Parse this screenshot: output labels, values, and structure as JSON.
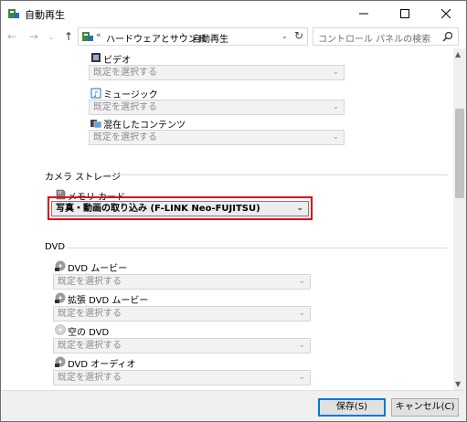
{
  "window": {
    "title": "自動再生"
  },
  "nav": {
    "address_chevron": "«",
    "address_segment_1": "ハードウェアとサウンド",
    "address_separator": "›",
    "address_segment_2": "自動再生",
    "search_placeholder": "コントロール パネルの検索"
  },
  "content": {
    "media_items": [
      {
        "label": "ビデオ",
        "icon": "video-icon",
        "value": "既定を選択する"
      },
      {
        "label": "ミュージック",
        "icon": "music-icon",
        "value": "既定を選択する"
      },
      {
        "label": "混在したコンテンツ",
        "icon": "mixed-content-icon",
        "value": "既定を選択する"
      }
    ],
    "camera_storage": {
      "title": "カメラ ストレージ",
      "items": [
        {
          "label": "メモリ カード",
          "icon": "memory-card-icon",
          "value": "写真・動画の取り込み (F-LINK Neo-FUJITSU)"
        }
      ]
    },
    "dvd": {
      "title": "DVD",
      "items": [
        {
          "label": "DVD ムービー",
          "icon": "dvd-icon",
          "value": "既定を選択する"
        },
        {
          "label": "拡張 DVD ムービー",
          "icon": "dvd-icon",
          "value": "既定を選択する"
        },
        {
          "label": "空の DVD",
          "icon": "blank-disc-icon",
          "value": "既定を選択する"
        },
        {
          "label": "DVD オーディオ",
          "icon": "dvd-icon",
          "value": "既定を選択する"
        }
      ]
    }
  },
  "footer": {
    "save_label": "保存(S)",
    "cancel_label": "キャンセル(C)"
  },
  "colors": {
    "highlight": "#e0001b",
    "default_button_border": "#0078d7"
  }
}
